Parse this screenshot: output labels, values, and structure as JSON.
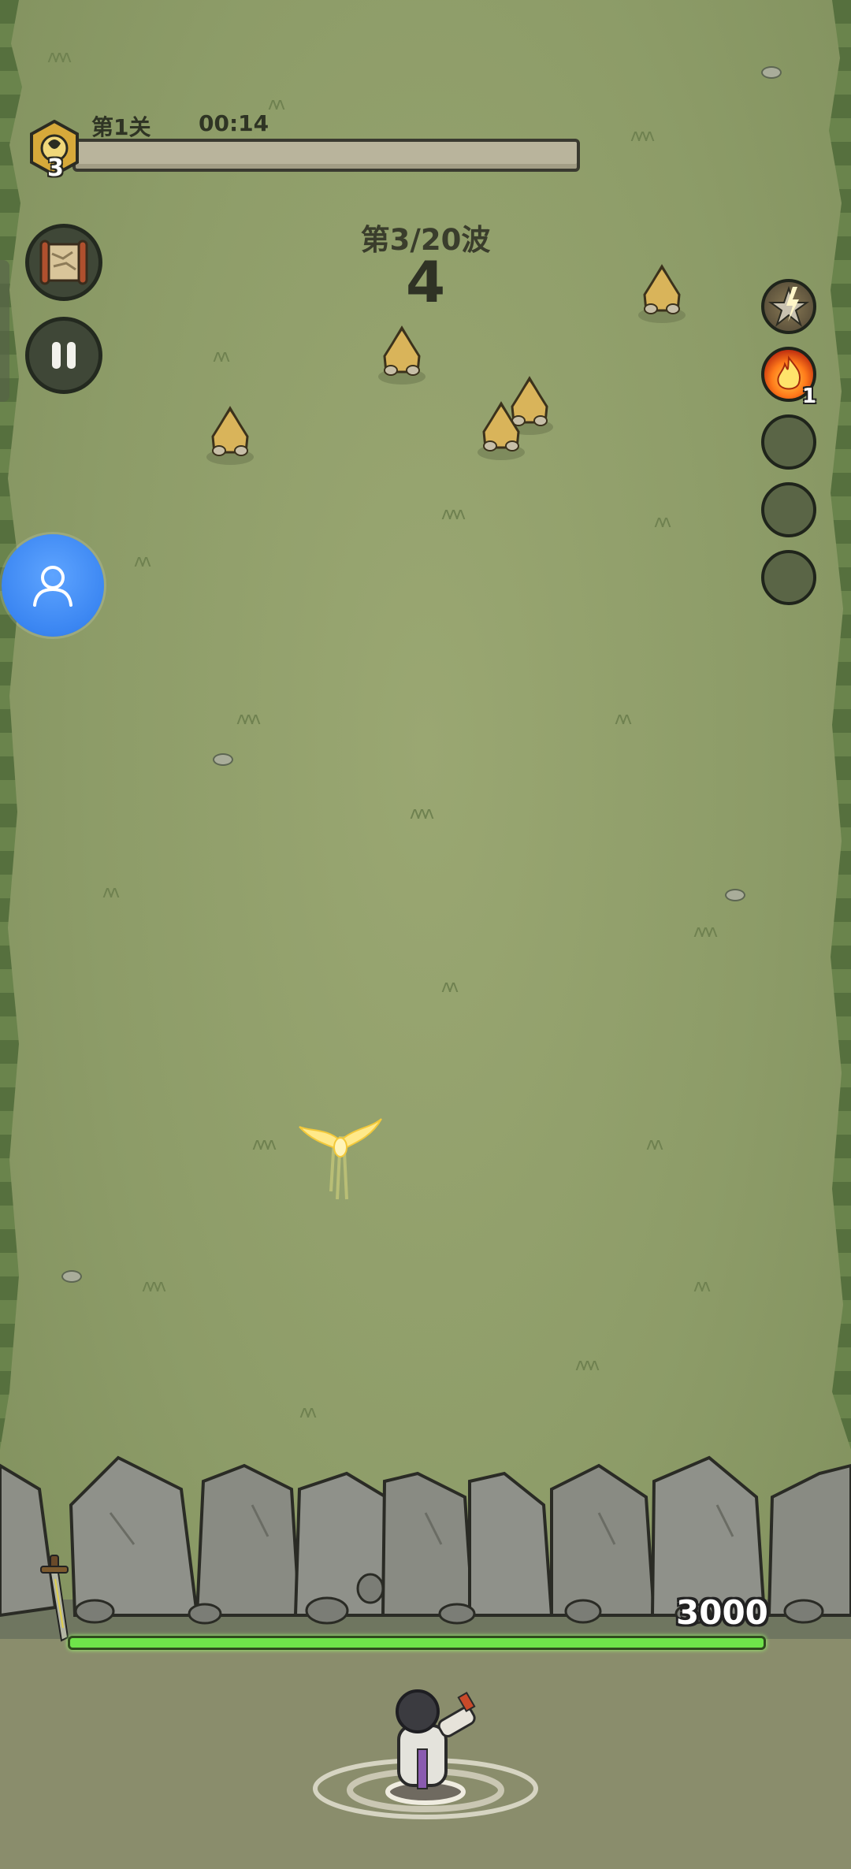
{
  "hud": {
    "stage_label": "第1关",
    "timer": "00:14",
    "level_number": "3",
    "stage_progress": 0.0
  },
  "wave": {
    "label": "第3/20波",
    "count": "4"
  },
  "skills": [
    {
      "icon": "lightning-star-icon",
      "count": ""
    },
    {
      "icon": "fire-icon",
      "count": "1"
    },
    {
      "icon": "empty-slot",
      "count": ""
    },
    {
      "icon": "empty-slot",
      "count": ""
    },
    {
      "icon": "empty-slot",
      "count": ""
    }
  ],
  "wall": {
    "hp": "3000",
    "hp_fraction": 1.0
  },
  "colors": {
    "field": "#8d9c68",
    "hp_bar": "#6fe34a",
    "assistant": "#3b86f2"
  },
  "icons": [
    "map-scroll-icon",
    "pause-icon",
    "user-icon",
    "golden-bird-icon",
    "sword-icon"
  ]
}
